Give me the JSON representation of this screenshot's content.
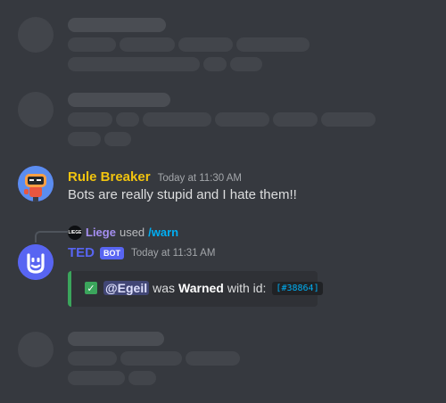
{
  "messages": {
    "rule_breaker": {
      "username": "Rule Breaker",
      "timestamp": "Today at 11:30 AM",
      "text": "Bots are really stupid and I hate them!!",
      "name_color": "#f1c40f"
    },
    "ted": {
      "reply_user": "Liege",
      "reply_used": "used",
      "reply_command": "/warn",
      "reply_avatar_text": "LIEGE",
      "username": "TED",
      "bot_tag": "BOT",
      "timestamp": "Today at 11:31 AM",
      "name_color": "#5865f2",
      "embed": {
        "mention": "@Egeil",
        "was": "was",
        "warned": "Warned",
        "with_id": "with id:",
        "case_id": "[#38864]",
        "accent": "#3ba55c"
      }
    }
  },
  "icons": {
    "rule_breaker_avatar": "robot-avatar-icon",
    "ted_avatar": "ted-bot-icon",
    "check": "check-box-icon"
  }
}
